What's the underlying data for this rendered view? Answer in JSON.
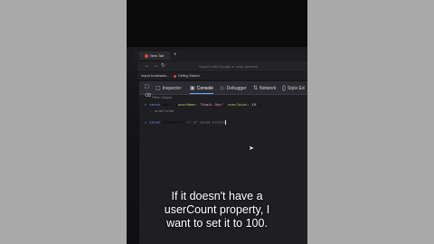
{
  "browser": {
    "tab_title": "New Tab",
    "new_tab_symbol": "+",
    "address_placeholder": "Search with Google or enter address",
    "bookmarks": [
      "Import bookmarks...",
      "Getting Started"
    ]
  },
  "devtools": {
    "tabs": [
      {
        "label": "Inspector",
        "icon": "inspector-icon",
        "active": false
      },
      {
        "label": "Console",
        "icon": "console-icon",
        "active": true
      },
      {
        "label": "Debugger",
        "icon": "debugger-icon",
        "active": false
      },
      {
        "label": "Network",
        "icon": "network-icon",
        "active": false
      },
      {
        "label": "Style Ed",
        "icon": "style-editor-icon",
        "active": false
      }
    ],
    "filter_placeholder": "Filter Output"
  },
  "console": {
    "line1": {
      "keyword": "const",
      "name": "obj",
      "op": "=",
      "open": "{",
      "key1": "userName:",
      "val1": "\"Sumit Das\"",
      "sep": ",",
      "key2": "userCount:",
      "val2": "10",
      "close": "};"
    },
    "result1": "undefined",
    "line2": {
      "keyword": "const",
      "name": "allUsers",
      "op": "=",
      "comment": "// if value exists"
    }
  },
  "caption": {
    "line1": "If it doesn't have a",
    "line2": "userCount property, I",
    "line3": "want to set it to 100."
  },
  "colors": {
    "side_bars": "#a9a9a9",
    "devtools_bg": "#1e1e23",
    "accent_blue": "#6aa6ff",
    "firefox_red": "#e8432c"
  }
}
